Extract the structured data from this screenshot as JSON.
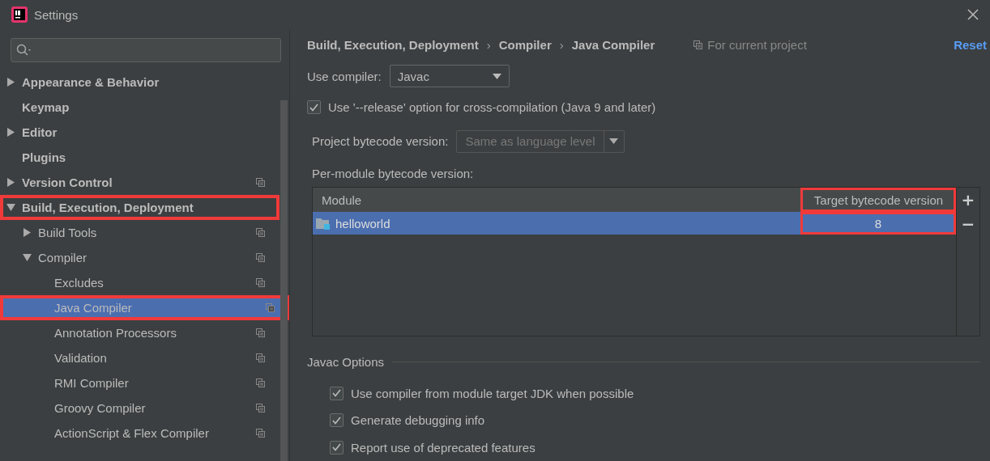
{
  "window": {
    "title": "Settings"
  },
  "sidebar": {
    "items": [
      {
        "label": "Appearance & Behavior",
        "bold": true,
        "expanded": false,
        "project_level": false,
        "selected": false,
        "highlighted": false
      },
      {
        "label": "Keymap",
        "bold": true,
        "project_level": false,
        "selected": false,
        "highlighted": false
      },
      {
        "label": "Editor",
        "bold": true,
        "expanded": false,
        "project_level": false,
        "selected": false,
        "highlighted": false
      },
      {
        "label": "Plugins",
        "bold": true,
        "project_level": false,
        "selected": false,
        "highlighted": false
      },
      {
        "label": "Version Control",
        "bold": true,
        "expanded": false,
        "project_level": true,
        "selected": false,
        "highlighted": false
      },
      {
        "label": "Build, Execution, Deployment",
        "bold": true,
        "expanded": true,
        "project_level": false,
        "selected": false,
        "highlighted": true,
        "children": [
          {
            "label": "Build Tools",
            "bold": false,
            "expanded": false,
            "project_level": true,
            "selected": false,
            "highlighted": false
          },
          {
            "label": "Compiler",
            "bold": false,
            "expanded": true,
            "project_level": true,
            "selected": false,
            "highlighted": false,
            "children": [
              {
                "label": "Excludes",
                "bold": false,
                "project_level": true,
                "selected": false,
                "highlighted": false
              },
              {
                "label": "Java Compiler",
                "bold": false,
                "project_level": true,
                "selected": true,
                "highlighted": true
              },
              {
                "label": "Annotation Processors",
                "bold": false,
                "project_level": true,
                "selected": false,
                "highlighted": false
              },
              {
                "label": "Validation",
                "bold": false,
                "project_level": true,
                "selected": false,
                "highlighted": false
              },
              {
                "label": "RMI Compiler",
                "bold": false,
                "project_level": true,
                "selected": false,
                "highlighted": false
              },
              {
                "label": "Groovy Compiler",
                "bold": false,
                "project_level": true,
                "selected": false,
                "highlighted": false
              },
              {
                "label": "ActionScript & Flex Compiler",
                "bold": false,
                "project_level": true,
                "selected": false,
                "highlighted": false
              }
            ]
          }
        ]
      }
    ]
  },
  "breadcrumb": [
    "Build, Execution, Deployment",
    "Compiler",
    "Java Compiler"
  ],
  "breadcrumb_separator": "›",
  "scope_note": "For current project",
  "reset_link": "Reset",
  "use_compiler": {
    "label": "Use compiler:",
    "value": "Javac"
  },
  "release_option": {
    "label": "Use '--release' option for cross-compilation (Java 9 and later)",
    "checked": true
  },
  "project_bytecode": {
    "label": "Project bytecode version:",
    "value": "Same as language level",
    "disabled": true
  },
  "per_module_label": "Per-module bytecode version:",
  "table": {
    "columns": [
      {
        "label": "Module",
        "highlighted": false
      },
      {
        "label": "Target bytecode version",
        "highlighted": true
      }
    ],
    "rows": [
      {
        "module": "helloworld",
        "version": "8",
        "selected": true
      }
    ],
    "add_button": "+",
    "remove_button": "−"
  },
  "javac_options": {
    "title": "Javac Options",
    "options": [
      {
        "label": "Use compiler from module target JDK when possible",
        "checked": true
      },
      {
        "label": "Generate debugging info",
        "checked": true
      },
      {
        "label": "Report use of deprecated features",
        "checked": true
      }
    ]
  }
}
